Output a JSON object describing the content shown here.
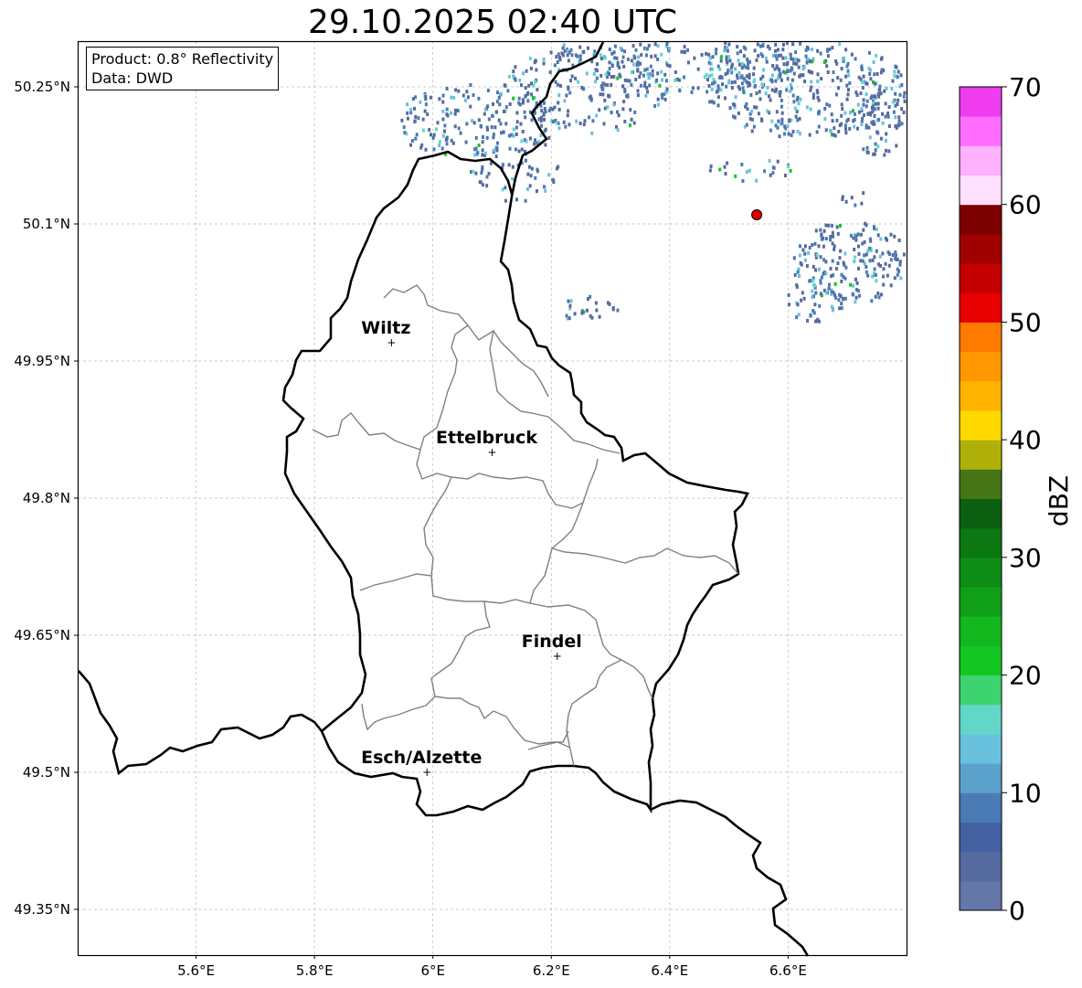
{
  "title": "29.10.2025 02:40 UTC",
  "info": {
    "product": "Product: 0.8° Reflectivity",
    "data": "Data: DWD"
  },
  "map": {
    "lon_range": [
      5.4,
      6.8
    ],
    "lat_range": [
      49.3,
      50.3
    ],
    "x_ticks": [
      {
        "value": 5.6,
        "label": "5.6°E"
      },
      {
        "value": 5.8,
        "label": "5.8°E"
      },
      {
        "value": 6.0,
        "label": "6°E"
      },
      {
        "value": 6.2,
        "label": "6.2°E"
      },
      {
        "value": 6.4,
        "label": "6.4°E"
      },
      {
        "value": 6.6,
        "label": "6.6°E"
      }
    ],
    "y_ticks": [
      {
        "value": 49.35,
        "label": "49.35°N"
      },
      {
        "value": 49.5,
        "label": "49.5°N"
      },
      {
        "value": 49.65,
        "label": "49.65°N"
      },
      {
        "value": 49.8,
        "label": "49.8°N"
      },
      {
        "value": 49.95,
        "label": "49.95°N"
      },
      {
        "value": 50.1,
        "label": "50.1°N"
      },
      {
        "value": 50.25,
        "label": "50.25°N"
      }
    ],
    "cities": [
      {
        "name": "Wiltz",
        "lon": 5.93,
        "lat": 49.97
      },
      {
        "name": "Ettelbruck",
        "lon": 6.1,
        "lat": 49.85
      },
      {
        "name": "Findel",
        "lon": 6.21,
        "lat": 49.627
      },
      {
        "name": "Esch/Alzette",
        "lon": 5.99,
        "lat": 49.5
      }
    ],
    "radar_site": {
      "lon": 6.547,
      "lat": 50.11,
      "color": "#dd0000"
    },
    "grid": true
  },
  "colorbar": {
    "label": "dBZ",
    "min": 0,
    "max": 70,
    "ticks": [
      "0",
      "10",
      "20",
      "30",
      "40",
      "50",
      "60",
      "70"
    ],
    "colors": [
      "#6577a8",
      "#556b9f",
      "#4461a2",
      "#4b7bb5",
      "#5aa2cb",
      "#69c2dd",
      "#62d7c8",
      "#3dd46f",
      "#13c622",
      "#13b81e",
      "#10a018",
      "#0d8c16",
      "#0c7812",
      "#0a6010",
      "#457514",
      "#afb10a",
      "#ffd800",
      "#ffb400",
      "#ff9800",
      "#ff7a00",
      "#e80000",
      "#c50000",
      "#a00000",
      "#7c0000",
      "#ffe0ff",
      "#ffb0ff",
      "#ff6eff",
      "#ee3cee"
    ]
  }
}
